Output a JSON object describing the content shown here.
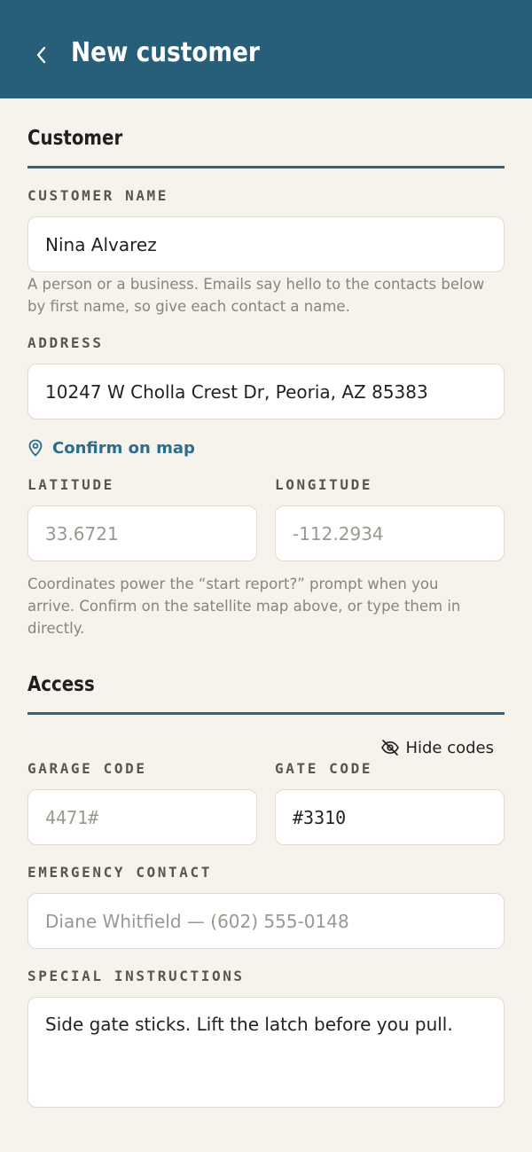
{
  "header": {
    "title": "New customer",
    "back_icon": "chevron-left-icon"
  },
  "customer_section": {
    "title": "Customer",
    "name_label": "CUSTOMER NAME",
    "name_value": "Nina Alvarez",
    "name_helper": "A person or a business. Emails say hello to the contacts below by first name, so give each contact a name.",
    "address_label": "ADDRESS",
    "address_value": "10247 W Cholla Crest Dr, Peoria, AZ 85383",
    "confirm_map_label": "Confirm on map",
    "latitude_label": "LATITUDE",
    "latitude_placeholder": "33.6721",
    "longitude_label": "LONGITUDE",
    "longitude_placeholder": "-112.2934",
    "coords_helper": "Coordinates power the “start report?” prompt when you arrive. Confirm on the satellite map above, or type them in directly."
  },
  "access_section": {
    "title": "Access",
    "hide_codes_label": "Hide codes",
    "garage_label": "GARAGE CODE",
    "garage_placeholder": "4471#",
    "gate_label": "GATE CODE",
    "gate_value": "#3310",
    "emergency_label": "EMERGENCY CONTACT",
    "emergency_placeholder": "Diane Whitfield — (602) 555-0148",
    "instructions_label": "SPECIAL INSTRUCTIONS",
    "instructions_value": "Side gate sticks. Lift the latch before you pull."
  },
  "colors": {
    "brand": "#275e79",
    "accent_link": "#2d6c8c",
    "background": "#f6f3ed"
  }
}
